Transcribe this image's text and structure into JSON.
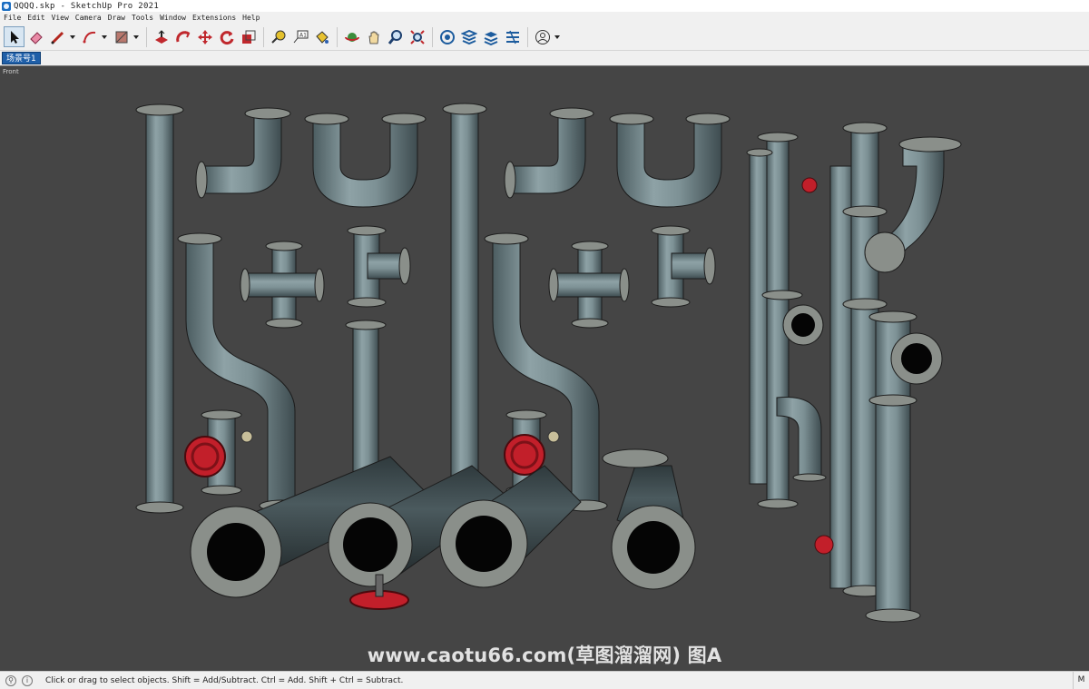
{
  "window": {
    "title": "QQQQ.skp - SketchUp Pro 2021"
  },
  "menu": {
    "items": [
      "File",
      "Edit",
      "View",
      "Camera",
      "Draw",
      "Tools",
      "Window",
      "Extensions",
      "Help"
    ]
  },
  "toolbar": {
    "tools": [
      {
        "name": "select-icon"
      },
      {
        "name": "eraser-icon"
      },
      {
        "name": "line-icon"
      },
      {
        "name": "arc-icon"
      },
      {
        "name": "rectangle-icon"
      },
      {
        "name": "push-pull-icon"
      },
      {
        "name": "offset-icon"
      },
      {
        "name": "move-icon"
      },
      {
        "name": "rotate-icon"
      },
      {
        "name": "scale-icon"
      },
      {
        "name": "tape-measure-icon"
      },
      {
        "name": "text-icon"
      },
      {
        "name": "paint-bucket-icon"
      },
      {
        "name": "orbit-icon"
      },
      {
        "name": "pan-icon"
      },
      {
        "name": "zoom-icon"
      },
      {
        "name": "zoom-extents-icon"
      },
      {
        "name": "warehouse-icon"
      },
      {
        "name": "extension-warehouse-icon"
      },
      {
        "name": "layout-icon"
      },
      {
        "name": "extension-manager-icon"
      },
      {
        "name": "account-icon"
      }
    ]
  },
  "scenes": {
    "active_tab": "场景号1"
  },
  "viewport": {
    "view_label": "Front",
    "watermark": "www.caotu66.com(草图溜溜网) 图A",
    "background_color": "#454545"
  },
  "status": {
    "hint": "Click or drag to select objects. Shift = Add/Subtract. Ctrl = Add. Shift + Ctrl = Subtract.",
    "measurements_label": "M"
  },
  "colors": {
    "pipe": "#6f8489",
    "flange": "#8a8f8a",
    "valve": "#c21f2a",
    "scene_tab": "#1f5fa8"
  }
}
